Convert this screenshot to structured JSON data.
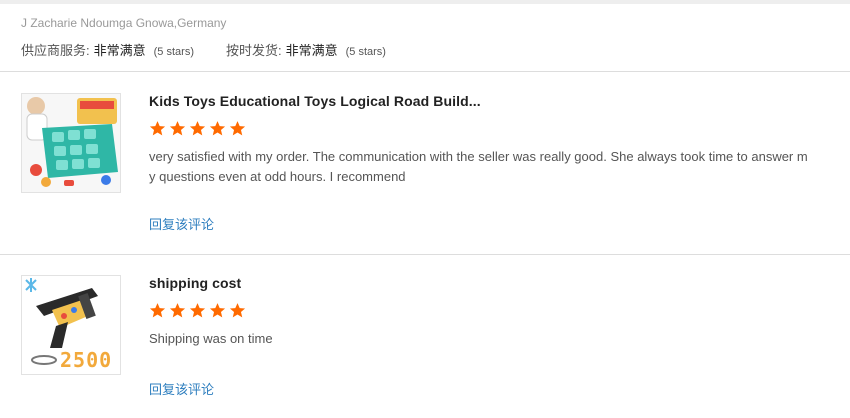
{
  "header": {
    "buyer": "J Zacharie Ndoumga Gnowa,Germany",
    "ratings": [
      {
        "label": "供应商服务:",
        "value": "非常满意",
        "stars": "(5 stars)"
      },
      {
        "label": "按时发货:",
        "value": "非常满意",
        "stars": "(5 stars)"
      }
    ]
  },
  "colors": {
    "star": "#ff6a00",
    "link": "#2f7fbf"
  },
  "reviews": [
    {
      "title": "Kids Toys Educational Toys Logical Road Build...",
      "rating": 5,
      "text": "very satisfied with my order. The communication with the seller was really good. She always took time to answer my questions even at odd hours. I recommend",
      "reply": "回复该评论",
      "thumb_icon": "toy-board-game-icon"
    },
    {
      "title": "shipping cost",
      "rating": 5,
      "text": "Shipping was on time",
      "reply": "回复该评论",
      "thumb_icon": "toy-gun-icon",
      "thumb_badge": "2500"
    }
  ]
}
